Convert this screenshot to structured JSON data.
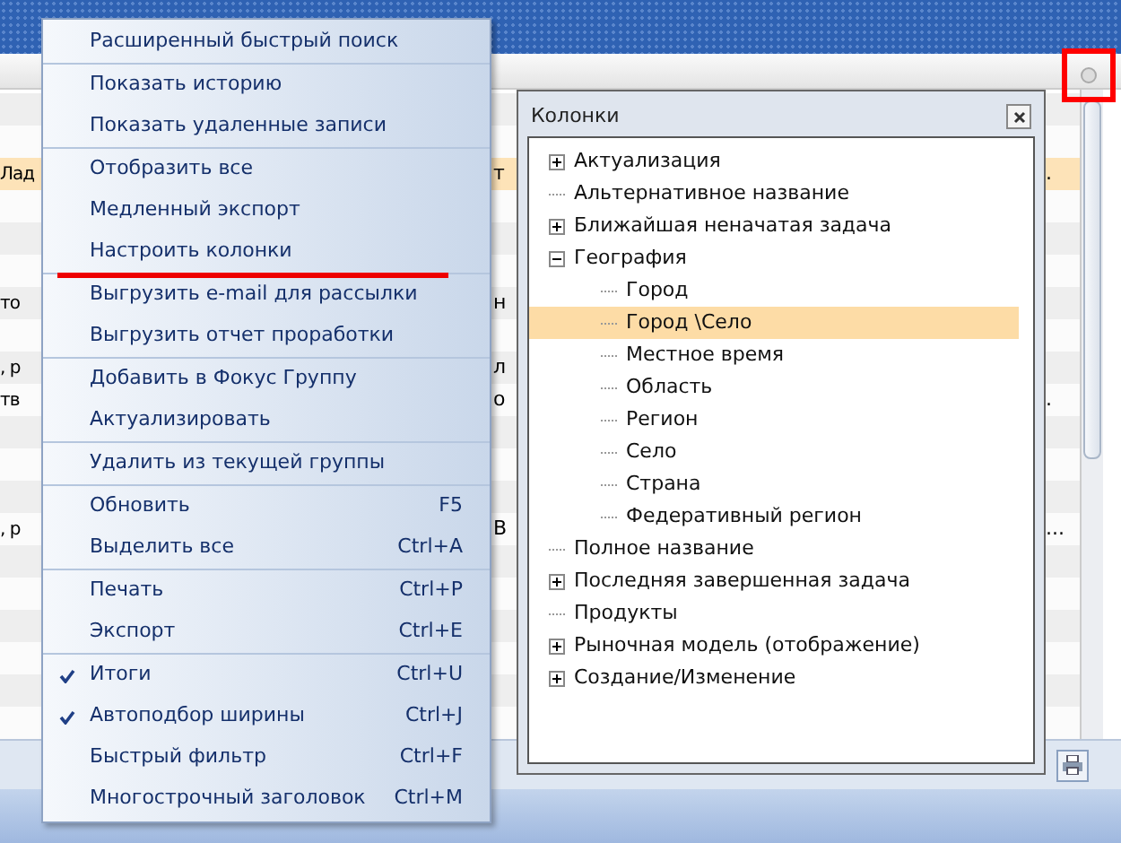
{
  "grid": {
    "rows": [
      {},
      {},
      {
        "left": "Лад",
        "mid": "т",
        "right": ".",
        "selected": true
      },
      {},
      {},
      {},
      {
        "left": "то",
        "mid": "н",
        "selected": false
      },
      {},
      {
        "left": ", р",
        "mid": "л",
        "selected": false
      },
      {
        "left": "тв",
        "mid": "о",
        "right": ".",
        "selected": false
      },
      {},
      {},
      {},
      {
        "left": ", р",
        "mid": "В",
        "right": "...",
        "selected": false
      },
      {},
      {},
      {},
      {},
      {},
      {}
    ]
  },
  "context_menu": {
    "groups": [
      [
        {
          "label": "Расширенный быстрый поиск",
          "checked": false
        }
      ],
      [
        {
          "label": "Показать историю",
          "checked": false
        },
        {
          "label": "Показать удаленные записи",
          "checked": false
        }
      ],
      [
        {
          "label": "Отобразить все",
          "checked": false
        },
        {
          "label": "Медленный экспорт",
          "checked": false
        },
        {
          "label": "Настроить колонки",
          "checked": false,
          "marked": true
        }
      ],
      [
        {
          "label": "Выгрузить e-mail для рассылки",
          "checked": false
        },
        {
          "label": "Выгрузить отчет проработки",
          "checked": false
        }
      ],
      [
        {
          "label": "Добавить в Фокус Группу",
          "checked": false
        },
        {
          "label": "Актуализировать",
          "checked": false
        }
      ],
      [
        {
          "label": "Удалить из текущей группы",
          "checked": false
        }
      ],
      [
        {
          "label": "Обновить",
          "shortcut": "F5",
          "checked": false
        },
        {
          "label": "Выделить все",
          "shortcut": "Ctrl+A",
          "checked": false
        }
      ],
      [
        {
          "label": "Печать",
          "shortcut": "Ctrl+P",
          "checked": false
        },
        {
          "label": "Экспорт",
          "shortcut": "Ctrl+E",
          "checked": false
        }
      ],
      [
        {
          "label": "Итоги",
          "shortcut": "Ctrl+U",
          "checked": true
        },
        {
          "label": "Автоподбор ширины",
          "shortcut": "Ctrl+J",
          "checked": true
        },
        {
          "label": "Быстрый фильтр",
          "shortcut": "Ctrl+F",
          "checked": false
        },
        {
          "label": "Многострочный заголовок",
          "shortcut": "Ctrl+M",
          "checked": false
        }
      ]
    ]
  },
  "columns_dialog": {
    "title": "Колонки",
    "tree": [
      {
        "label": "Актуализация",
        "expanded": false,
        "selected": false
      },
      {
        "label": "Альтернативное название",
        "selected": false
      },
      {
        "label": "Ближайшая неначатая задача",
        "expanded": false,
        "selected": false
      },
      {
        "label": "География",
        "expanded": true,
        "selected": false,
        "children": [
          {
            "label": "Город",
            "selected": false
          },
          {
            "label": "Город \\Село",
            "selected": true
          },
          {
            "label": "Местное время",
            "selected": false
          },
          {
            "label": "Область",
            "selected": false
          },
          {
            "label": "Регион",
            "selected": false
          },
          {
            "label": "Село",
            "selected": false
          },
          {
            "label": "Страна",
            "selected": false
          },
          {
            "label": "Федеративный регион",
            "selected": false
          }
        ]
      },
      {
        "label": "Полное название",
        "selected": false
      },
      {
        "label": "Последняя завершенная задача",
        "expanded": false,
        "selected": false
      },
      {
        "label": "Продукты",
        "selected": false
      },
      {
        "label": "Рыночная модель (отображение)",
        "expanded": false,
        "selected": false
      },
      {
        "label": "Создание/Изменение",
        "expanded": false,
        "selected": false
      }
    ]
  }
}
